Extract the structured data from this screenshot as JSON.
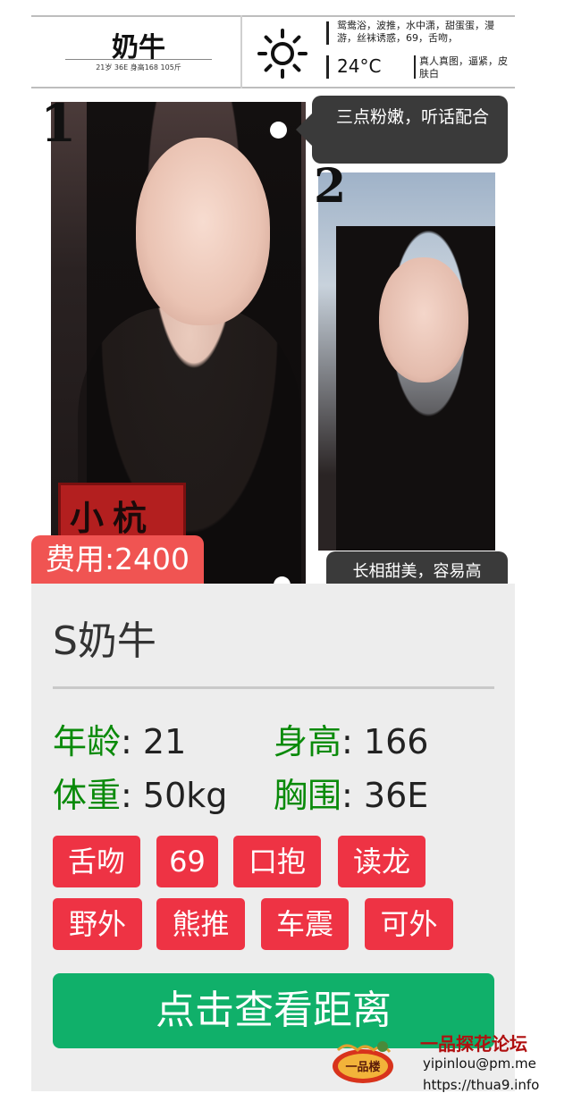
{
  "header": {
    "name": "奶牛",
    "stats_line": "21岁  36E  身高168  105斤",
    "services": "鸳鸯浴，波推，水中潇，甜蛋蛋，漫游，丝袜诱惑，69，舌吻，",
    "temperature": "24°C",
    "real_note": "真人真图，逼紧，皮肤白"
  },
  "poster": {
    "num_1": "1",
    "num_2": "2",
    "bubble_1": "三点粉嫩，听话配合",
    "bubble_2": "长相甜美，容易高",
    "stamp_text": "小杭",
    "fee": "费用:2400"
  },
  "card": {
    "title": "S奶牛",
    "age_label": "年龄",
    "age_value": ": 21",
    "height_label": "身高",
    "height_value": ": 166",
    "weight_label": "体重",
    "weight_value": ": 50kg",
    "bust_label": "胸围",
    "bust_value": ": 36E",
    "tags": [
      "舌吻",
      "69",
      "口抱",
      "读龙",
      "野外",
      "熊推",
      "车震",
      "可外"
    ],
    "cta": "点击查看距离"
  },
  "watermark": {
    "logo_text": "一品楼",
    "title": "一品探花论坛",
    "email": "yipinlou@pm.me",
    "url": "https://thua9.info"
  },
  "colors": {
    "fee_red": "#f05452",
    "tag_red": "#ee3344",
    "label_green": "#0a8a0a",
    "cta_green": "#10b06a",
    "card_bg": "#ededed"
  }
}
